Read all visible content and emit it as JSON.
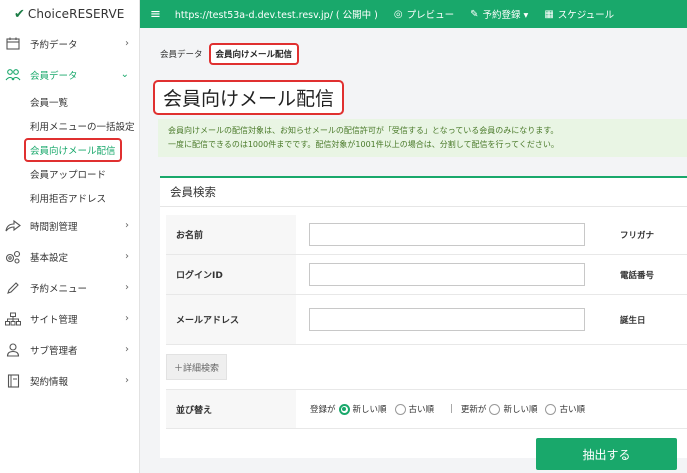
{
  "brand": {
    "name": "ChoiceRESERVE",
    "check": "✔"
  },
  "topbar": {
    "menu_icon": "hamburger-icon",
    "url": "https://test53a-d.dev.test.resv.jp/ ( 公開中 )",
    "preview": "プレビュー",
    "booking": "予約登録 ▾",
    "schedule": "スケジュール"
  },
  "sidebar": {
    "items": [
      {
        "label": "予約データ",
        "icon": "calendar-icon"
      },
      {
        "label": "会員データ",
        "icon": "members-icon"
      },
      {
        "label": "時間割管理",
        "icon": "share-icon"
      },
      {
        "label": "基本設定",
        "icon": "gears-icon"
      },
      {
        "label": "予約メニュー",
        "icon": "pencil-icon"
      },
      {
        "label": "サイト管理",
        "icon": "sitemap-icon"
      },
      {
        "label": "サブ管理者",
        "icon": "user-icon"
      },
      {
        "label": "契約情報",
        "icon": "document-icon"
      }
    ],
    "sub_items": [
      "会員一覧",
      "利用メニューの一括設定",
      "会員向けメール配信",
      "会員アップロード",
      "利用拒否アドレス"
    ]
  },
  "breadcrumb": {
    "parent": "会員データ",
    "current": "会員向けメール配信"
  },
  "page_title": "会員向けメール配信",
  "notice": {
    "line1": "会員向けメールの配信対象は、お知らせメールの配信許可が「受信する」となっている会員のみになります。",
    "line2": "一度に配信できるのは1000件までです。配信対象が1001件以上の場合は、分割して配信を行ってください。"
  },
  "search": {
    "title": "会員検索",
    "rows": [
      {
        "label": "お名前",
        "label2": "フリガナ",
        "value": ""
      },
      {
        "label": "ログインID",
        "label2": "電話番号",
        "value": ""
      },
      {
        "label": "メールアドレス",
        "label2": "誕生日",
        "value": ""
      }
    ],
    "advanced": "＋詳細検索"
  },
  "sort": {
    "label": "並び替え",
    "group1_prefix": "登録が",
    "new": "新しい順",
    "old": "古い順",
    "separator": "|",
    "group2_prefix": "更新が",
    "group1_selected": "新しい順",
    "group2_selected": ""
  },
  "submit": "抽出する"
}
